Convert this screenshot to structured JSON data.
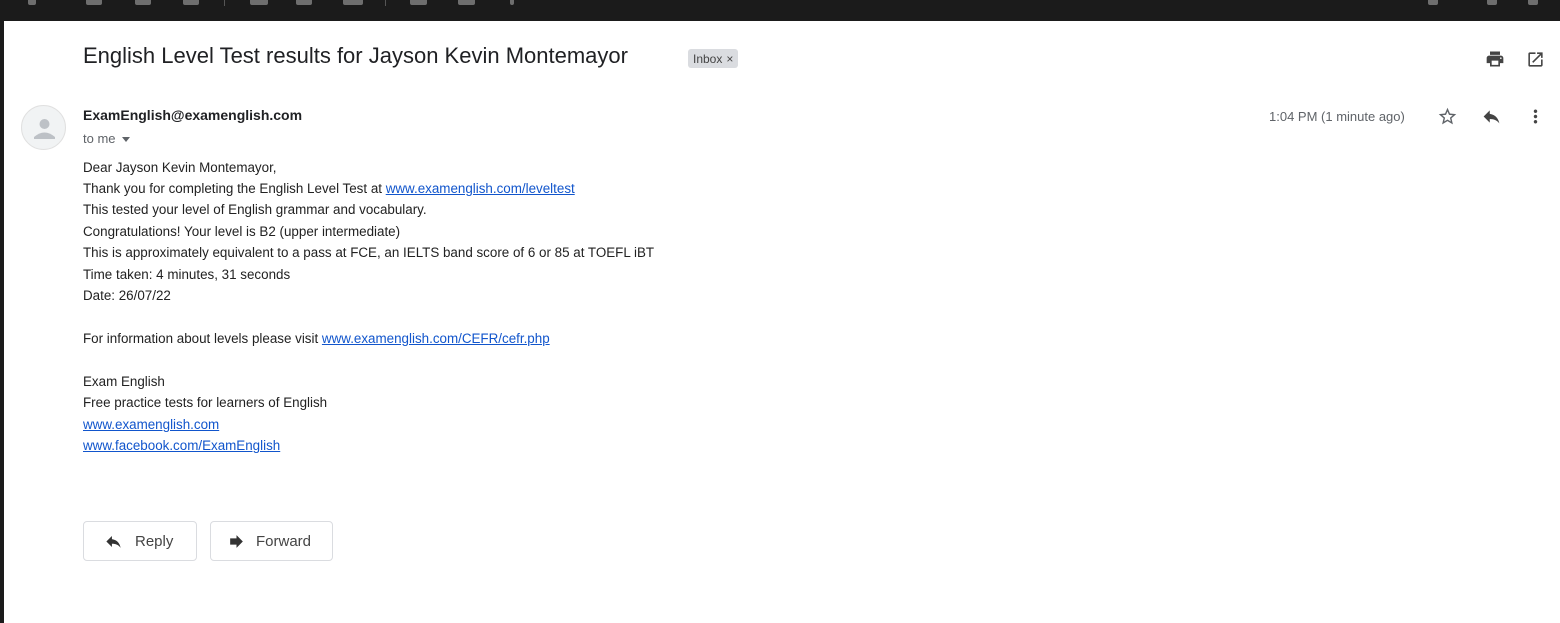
{
  "email": {
    "subject": "English Level Test results for Jayson Kevin Montemayor",
    "label": "Inbox",
    "label_remove": "×",
    "sender": "ExamEnglish@examenglish.com",
    "recipient": "to me",
    "timestamp": "1:04 PM (1 minute ago)",
    "body": {
      "greeting": "Dear Jayson Kevin Montemayor,",
      "thanks_prefix": "Thank you for completing the English Level Test at ",
      "thanks_link": "www.examenglish.com/leveltest",
      "tested": "This tested your level of English grammar and vocabulary.",
      "congrats": "Congratulations! Your level is B2 (upper intermediate)",
      "equivalent": "This is approximately equivalent to a pass at FCE, an IELTS band score of 6 or 85 at TOEFL iBT",
      "time_taken": "Time taken: 4 minutes, 31 seconds",
      "date": "Date: 26/07/22",
      "info_prefix": "For information about levels please visit ",
      "info_link": "www.examenglish.com/CEFR/cefr.php",
      "sig_name": "Exam English",
      "sig_tagline": "Free practice tests for learners of English",
      "sig_site": "www.examenglish.com",
      "sig_facebook": "www.facebook.com/ExamEnglish"
    }
  },
  "actions": {
    "reply": "Reply",
    "forward": "Forward"
  },
  "icons": [
    "print-icon",
    "open-in-new-window-icon",
    "avatar-person-icon",
    "star-icon",
    "reply-icon",
    "more-vert-icon",
    "reply-arrow-icon",
    "forward-arrow-icon"
  ],
  "colors": {
    "link": "#1155cc",
    "topbar": "#1b1b1b",
    "chip": "#dadce0"
  }
}
